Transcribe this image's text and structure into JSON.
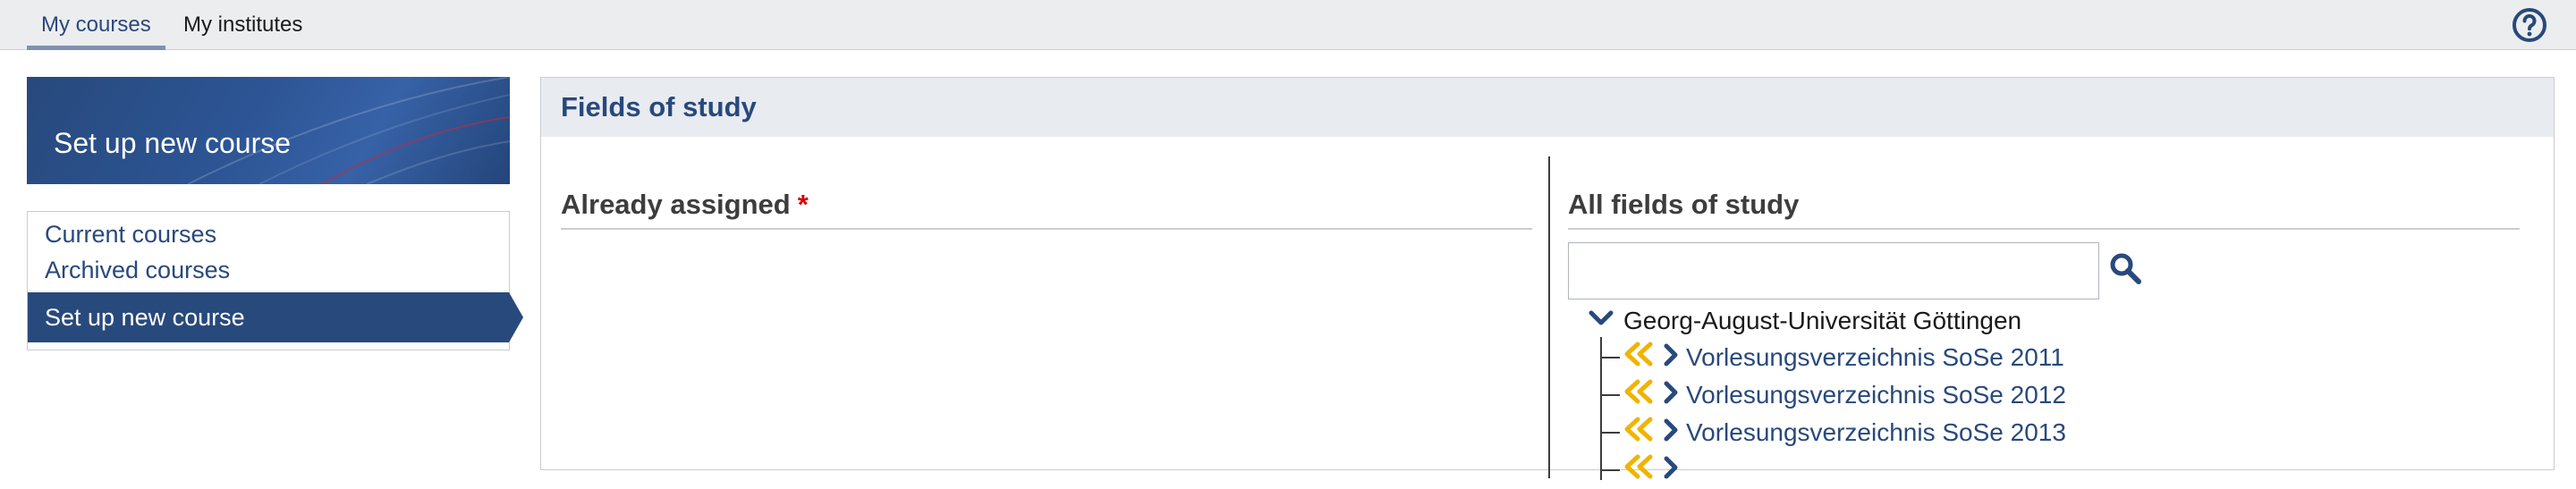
{
  "nav": {
    "tabs": [
      {
        "label": "My courses",
        "active": true
      },
      {
        "label": "My institutes",
        "active": false
      }
    ],
    "help_icon": "help-circle-icon"
  },
  "sidebar": {
    "banner_title": "Set up new course",
    "links": [
      {
        "label": "Current courses"
      },
      {
        "label": "Archived courses"
      },
      {
        "label": "Set up new course",
        "active": true
      }
    ]
  },
  "main": {
    "panel_title": "Fields of study",
    "assigned": {
      "title": "Already assigned",
      "required_mark": "*"
    },
    "all_fields": {
      "title": "All fields of study",
      "search_value": "",
      "search_icon": "magnifier-icon",
      "tree": {
        "root": "Georg-August-Universität Göttingen",
        "items": [
          {
            "label": "Vorlesungsverzeichnis SoSe 2011"
          },
          {
            "label": "Vorlesungsverzeichnis SoSe 2012"
          },
          {
            "label": "Vorlesungsverzeichnis SoSe 2013"
          },
          {
            "label": ""
          }
        ]
      }
    }
  },
  "colors": {
    "brand": "#28497c",
    "accent_add": "#f0b400",
    "required": "#d60000"
  }
}
